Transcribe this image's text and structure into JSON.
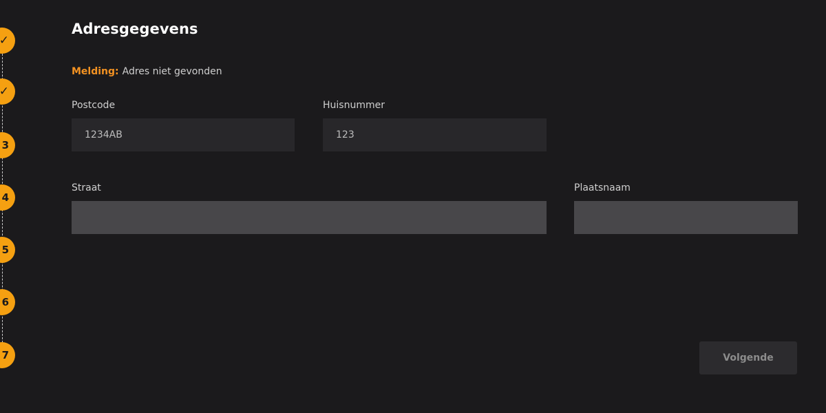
{
  "stepper": {
    "steps": [
      {
        "label": "✓",
        "state": "done"
      },
      {
        "label": "✓",
        "state": "done"
      },
      {
        "label": "3",
        "state": "pending"
      },
      {
        "label": "4",
        "state": "pending"
      },
      {
        "label": "5",
        "state": "pending"
      },
      {
        "label": "6",
        "state": "pending"
      },
      {
        "label": "7",
        "state": "pending"
      }
    ],
    "accent_color": "#f5a011"
  },
  "form": {
    "title": "Adresgegevens",
    "notice": {
      "label": "Melding:",
      "text": "Adres niet gevonden",
      "label_color": "#f39222"
    },
    "postcode": {
      "label": "Postcode",
      "value": "1234AB"
    },
    "huisnummer": {
      "label": "Huisnummer",
      "value": "123"
    },
    "straat": {
      "label": "Straat",
      "value": ""
    },
    "plaatsnaam": {
      "label": "Plaatsnaam",
      "value": ""
    },
    "next_button": {
      "label": "Volgende",
      "enabled": false
    }
  }
}
